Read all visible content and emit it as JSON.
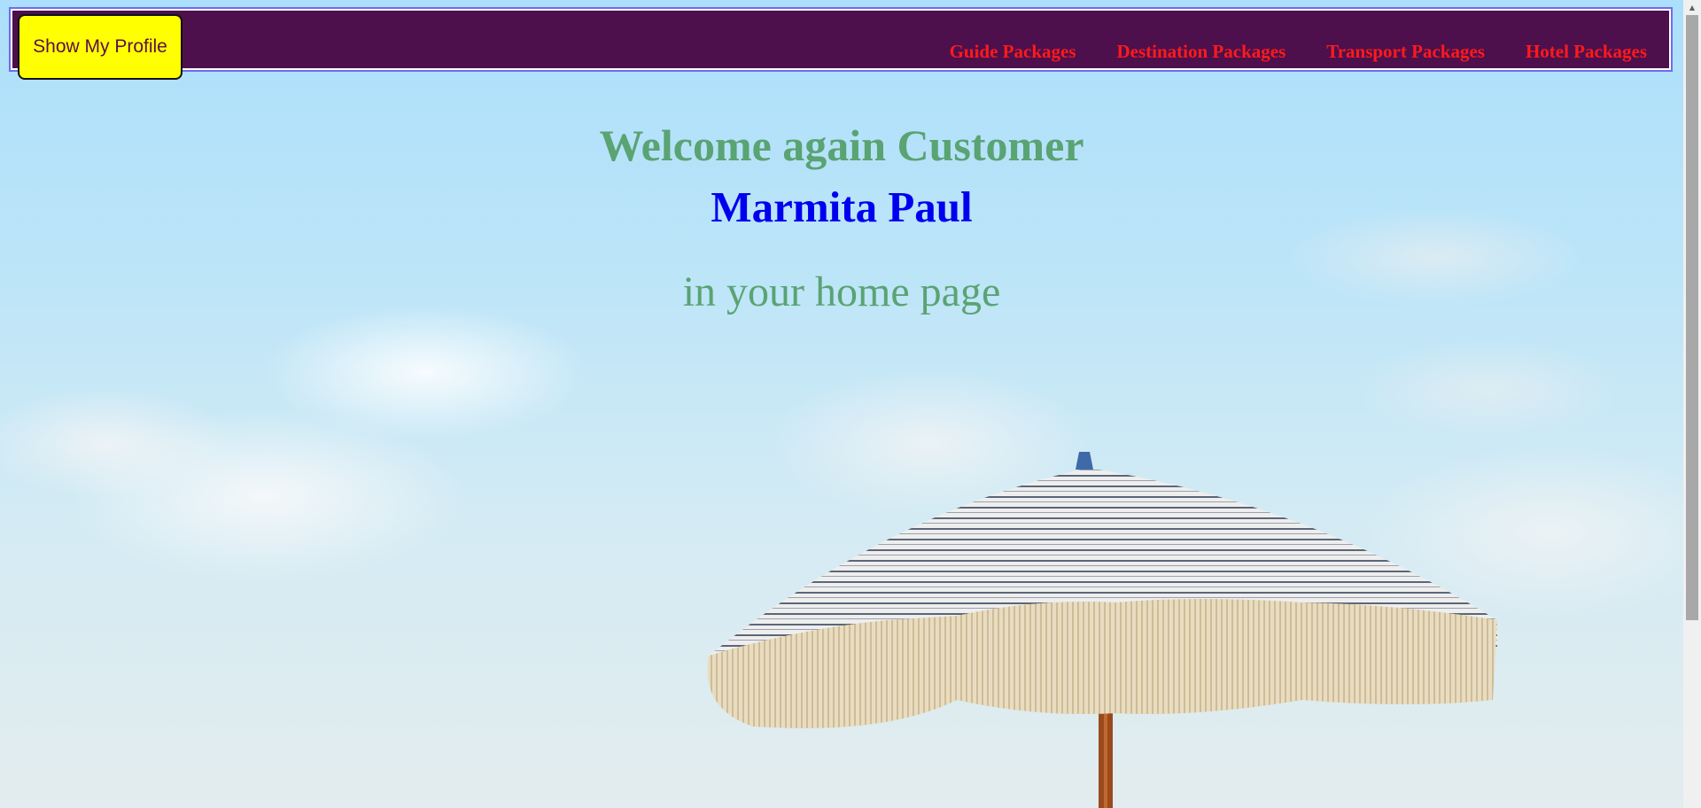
{
  "header": {
    "profile_button_label": "Show My Profile",
    "nav_links": [
      {
        "label": "Guide Packages"
      },
      {
        "label": "Destination Packages"
      },
      {
        "label": "Transport Packages"
      },
      {
        "label": "Hotel Packages"
      }
    ]
  },
  "main": {
    "welcome_text": "Welcome again Customer",
    "customer_name": "Marmita Paul",
    "subtext": "in your home page"
  },
  "colors": {
    "navbar_bg": "#4e0f4d",
    "navbar_border": "#6f6cf0",
    "profile_button_bg": "#ffff00",
    "nav_link": "#ff1a1a",
    "welcome_text": "#5aa373",
    "customer_name": "#0000ee"
  },
  "background": {
    "image_subject": "beach-umbrella-under-cloudy-sky"
  }
}
